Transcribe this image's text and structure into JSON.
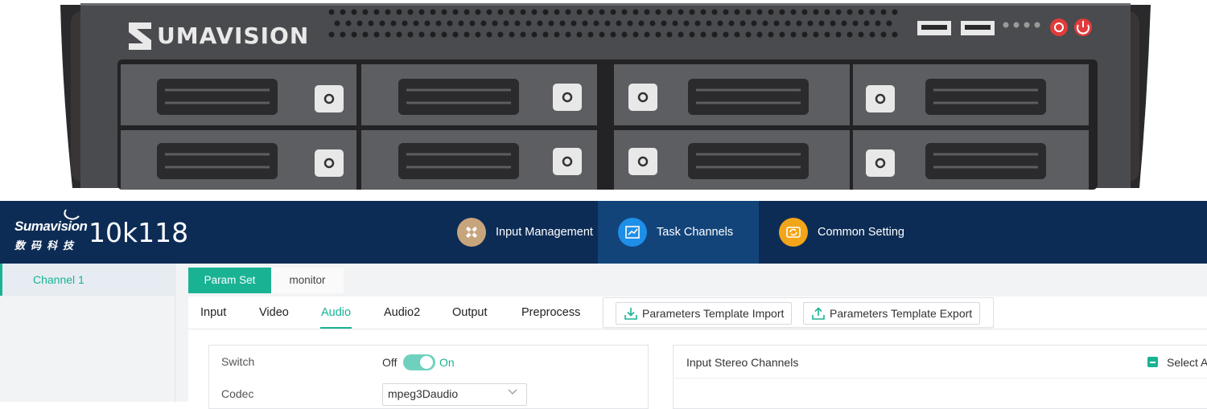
{
  "device": {
    "brand": "UMAVISION"
  },
  "header": {
    "logo_text": "Sumavision",
    "logo_cn": "数码科技",
    "product": "10k118",
    "nav": [
      {
        "label": "Input Management",
        "icon": "satellite-icon",
        "color": "#c7a57c"
      },
      {
        "label": "Task Channels",
        "icon": "chart-icon",
        "color": "#1e8fe8",
        "active": true
      },
      {
        "label": "Common Setting",
        "icon": "refresh-icon",
        "color": "#f2a518"
      }
    ]
  },
  "sidebar": {
    "items": [
      {
        "label": "Channel 1",
        "active": true
      }
    ]
  },
  "tabs": [
    {
      "label": "Param Set",
      "active": true
    },
    {
      "label": "monitor"
    }
  ],
  "subtabs": [
    {
      "label": "Input"
    },
    {
      "label": "Video"
    },
    {
      "label": "Audio",
      "active": true
    },
    {
      "label": "Audio2"
    },
    {
      "label": "Output"
    },
    {
      "label": "Preprocess"
    }
  ],
  "template": {
    "import_label": "Parameters Template Import",
    "export_label": "Parameters Template Export"
  },
  "form": {
    "switch_label": "Switch",
    "switch_off": "Off",
    "switch_on": "On",
    "switch_value": true,
    "codec_label": "Codec",
    "codec_value": "mpeg3Daudio"
  },
  "stereo": {
    "title": "Input Stereo Channels",
    "select_all": "Select A"
  },
  "colors": {
    "accent": "#19b394",
    "header_bg": "#0c2c55",
    "nav_active_bg": "#12447a"
  }
}
